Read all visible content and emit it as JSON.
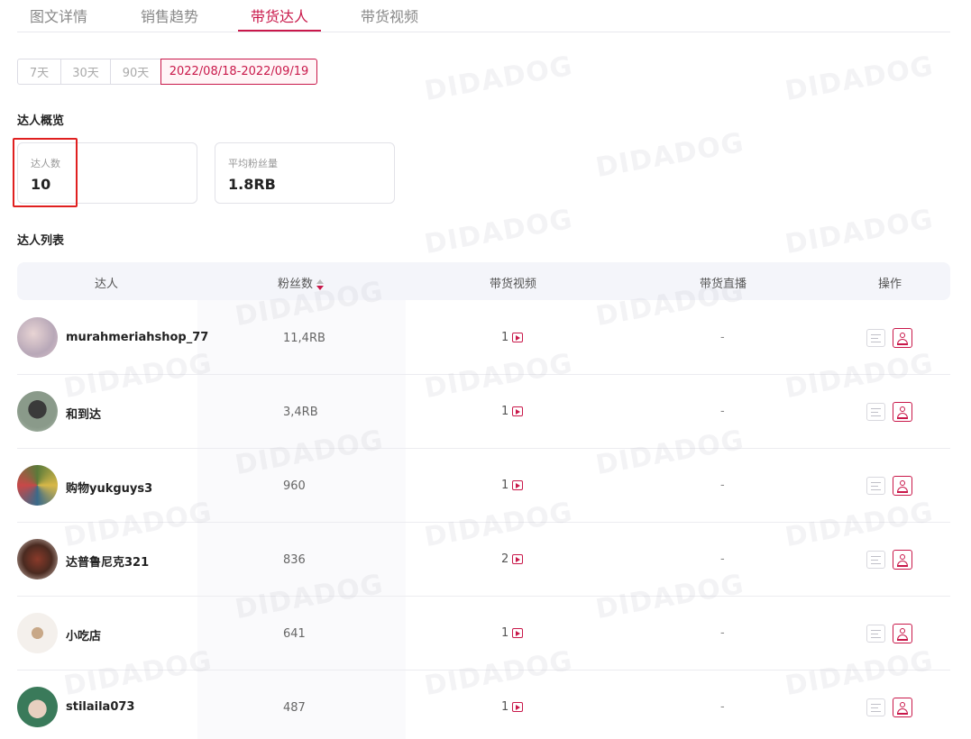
{
  "tabs": [
    "图文详情",
    "销售趋势",
    "带货达人",
    "带货视频"
  ],
  "active_tab": "带货达人",
  "date_range": {
    "options": [
      "7天",
      "30天",
      "90天"
    ],
    "selected": "2022/08/18-2022/09/19"
  },
  "overview": {
    "title": "达人概览",
    "cards": [
      {
        "label": "达人数",
        "value": "10"
      },
      {
        "label": "平均粉丝量",
        "value": "1.8RB"
      }
    ]
  },
  "list": {
    "title": "达人列表",
    "columns": [
      "达人",
      "粉丝数",
      "带货视频",
      "带货直播",
      "操作"
    ],
    "rows": [
      {
        "name": "murahmeriahshop_77",
        "fans": "11,4RB",
        "videos": "1",
        "live": "-"
      },
      {
        "name": "和到达",
        "fans": "3,4RB",
        "videos": "1",
        "live": "-"
      },
      {
        "name": "购物yukguys3",
        "fans": "960",
        "videos": "1",
        "live": "-"
      },
      {
        "name": "达普鲁尼克321",
        "fans": "836",
        "videos": "2",
        "live": "-"
      },
      {
        "name": "小吃店",
        "fans": "641",
        "videos": "1",
        "live": "-"
      },
      {
        "name": "stilaila073",
        "fans": "487",
        "videos": "1",
        "live": "-"
      }
    ]
  },
  "watermark": "DIDADOG",
  "colors": {
    "accent": "#c9184a",
    "highlight_box": "#e02020"
  }
}
